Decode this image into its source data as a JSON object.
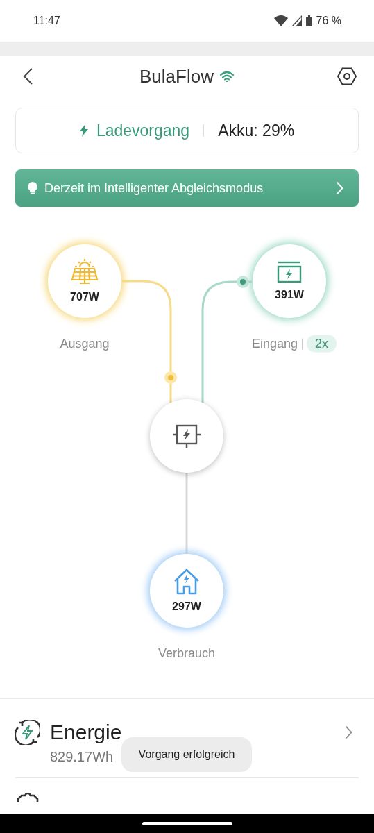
{
  "status_bar": {
    "time": "11:47",
    "battery": "76 %"
  },
  "header": {
    "title": "BulaFlow"
  },
  "status_card": {
    "state": "Ladevorgang",
    "battery": "Akku: 29%"
  },
  "mode_banner": {
    "text": "Derzeit im Intelligenter Abgleichsmodus"
  },
  "flow": {
    "nodes": [
      {
        "kind": "solar",
        "power": "707W",
        "label": "Ausgang"
      },
      {
        "kind": "input",
        "power": "391W",
        "label": "Eingang",
        "badge": "2x"
      },
      {
        "kind": "hub"
      },
      {
        "kind": "home",
        "power": "297W",
        "label": "Verbrauch"
      }
    ]
  },
  "energy": {
    "title": "Energie",
    "summary": "829.17Wh"
  },
  "toast": {
    "text": "Vorgang erfolgreich"
  }
}
